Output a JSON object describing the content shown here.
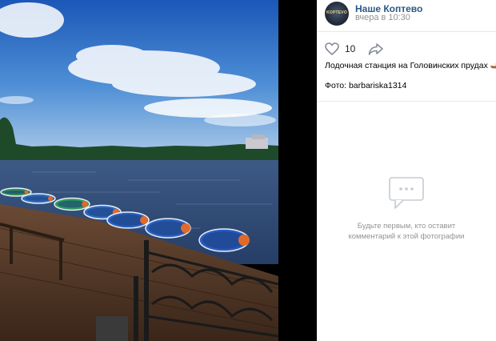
{
  "post": {
    "group_name": "Наше Коптево",
    "time": "вчера в 10:30",
    "avatar_text": "KOPTEVO",
    "like_count": "10",
    "text": "Лодочная станция на Головинских прудах 🛶",
    "credit": "Фото: barbariska1314"
  },
  "comments": {
    "empty_line1": "Будьте первым, кто оставит",
    "empty_line2": "комментарий к этой фотографии"
  },
  "boats": [
    {
      "color": "#2e8b57"
    },
    {
      "color": "#2f6fc0"
    },
    {
      "color": "#2e9c5a"
    },
    {
      "color": "#2d6ac2"
    },
    {
      "color": "#2a5fc0"
    },
    {
      "color": "#2c62c4"
    },
    {
      "color": "#2a5cc6"
    }
  ],
  "icons": {
    "like": "heart-icon",
    "share": "share-arrow-icon",
    "comments": "comment-bubble-icon"
  },
  "colors": {
    "link": "#2a5885",
    "muted": "#939393",
    "sky_top": "#1f5fbf",
    "water": "#2f4f7f"
  }
}
